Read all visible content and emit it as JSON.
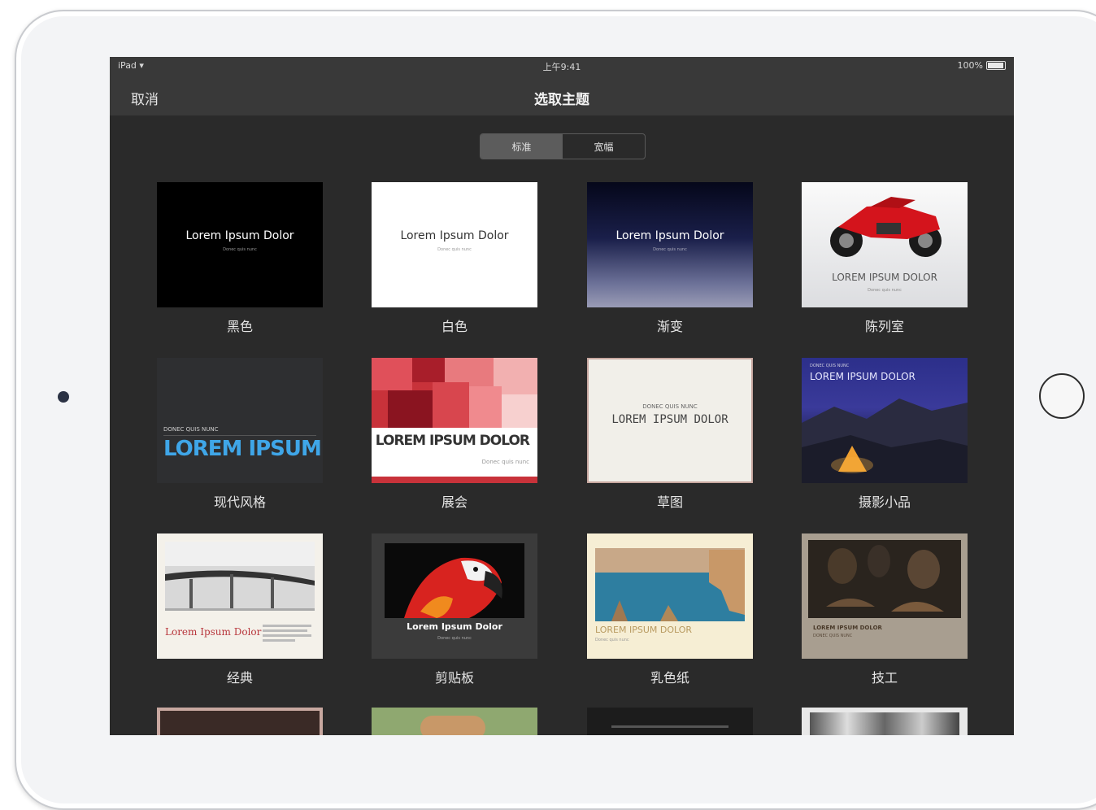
{
  "status_bar": {
    "device": "iPad",
    "time": "上午9:41",
    "battery": "100%"
  },
  "nav": {
    "cancel": "取消",
    "title": "选取主题"
  },
  "segmented": {
    "standard": "标准",
    "wide": "宽幅"
  },
  "themes": [
    {
      "name": "黑色",
      "title": "Lorem Ipsum Dolor",
      "subtitle": "Donec quis nunc"
    },
    {
      "name": "白色",
      "title": "Lorem Ipsum Dolor",
      "subtitle": "Donec quis nunc"
    },
    {
      "name": "渐变",
      "title": "Lorem Ipsum Dolor",
      "subtitle": "Donec quis nunc"
    },
    {
      "name": "陈列室",
      "title": "LOREM IPSUM DOLOR",
      "subtitle": "Donec quis nunc"
    },
    {
      "name": "现代风格",
      "title": "LOREM IPSUM",
      "subtitle": "DONEC QUIS NUNC"
    },
    {
      "name": "展会",
      "title": "LOREM IPSUM DOLOR",
      "subtitle": "Donec quis nunc"
    },
    {
      "name": "草图",
      "title": "LOREM IPSUM DOLOR",
      "subtitle": "DONEC QUIS NUNC"
    },
    {
      "name": "摄影小品",
      "title": "LOREM IPSUM DOLOR",
      "subtitle": "DONEC QUIS NUNC"
    },
    {
      "name": "经典",
      "title": "Lorem Ipsum Dolor",
      "subtitle": ""
    },
    {
      "name": "剪贴板",
      "title": "Lorem Ipsum Dolor",
      "subtitle": "Donec quis nunc"
    },
    {
      "name": "乳色纸",
      "title": "LOREM IPSUM DOLOR",
      "subtitle": "Donec quis nunc"
    },
    {
      "name": "技工",
      "title": "LOREM IPSUM DOLOR",
      "subtitle": "DONEC QUIS NUNC"
    }
  ]
}
